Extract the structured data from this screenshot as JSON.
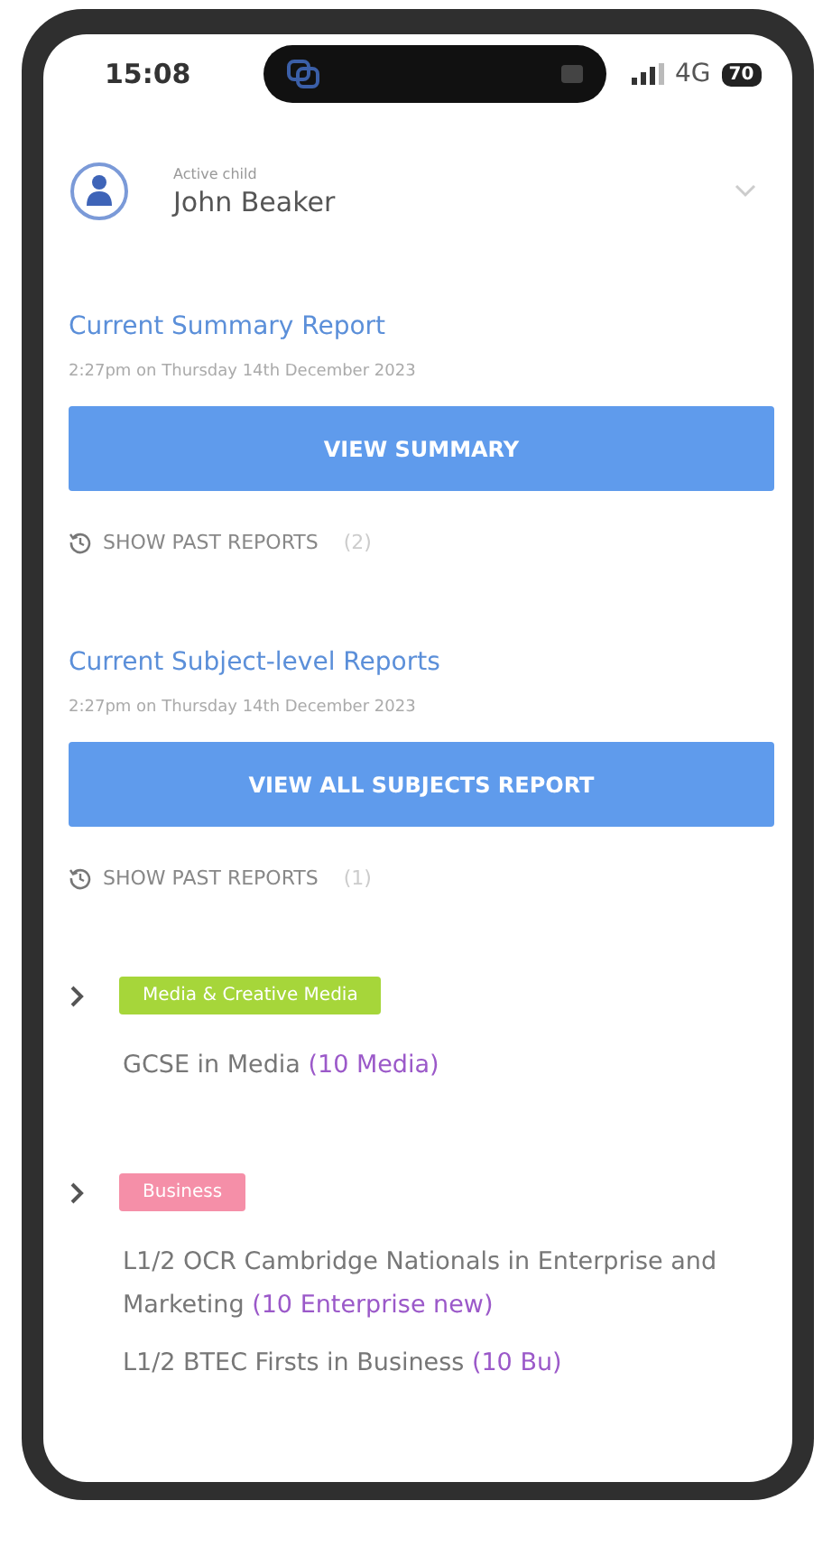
{
  "status_bar": {
    "time": "15:08",
    "network": "4G",
    "battery": "70"
  },
  "child_picker": {
    "label": "Active child",
    "value": "John Beaker"
  },
  "reports": [
    {
      "title": "Current Summary Report",
      "timestamp": "2:27pm on Thursday 14th December 2023",
      "button": "VIEW SUMMARY",
      "past_label": "SHOW PAST REPORTS",
      "past_count": "(2)"
    },
    {
      "title": "Current Subject-level Reports",
      "timestamp": "2:27pm on Thursday 14th December 2023",
      "button": "VIEW ALL SUBJECTS REPORT",
      "past_label": "SHOW PAST REPORTS",
      "past_count": "(1)"
    }
  ],
  "subjects": [
    {
      "tag": "Media & Creative Media",
      "color": "#a6d63a",
      "expanded": false,
      "courses": [
        {
          "name": "GCSE in Media",
          "class": "(10 Media)"
        }
      ]
    },
    {
      "tag": "Business",
      "color": "#f58fa8",
      "expanded": false,
      "courses": [
        {
          "name": "L1/2 OCR Cambridge Nationals in Enterprise and Marketing",
          "class": "(10 Enterprise new)"
        },
        {
          "name": "L1/2 BTEC Firsts in Business",
          "class": "(10 Bu)"
        }
      ]
    }
  ]
}
